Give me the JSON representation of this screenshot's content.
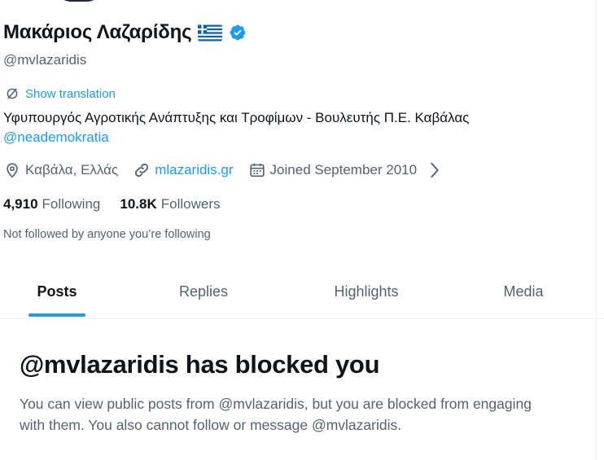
{
  "profile": {
    "display_name": "Μακάριος Λαζαρίδης",
    "flag_icon": "greece-flag-icon",
    "verified_icon": "verified-badge-icon",
    "verified_color": "#1d9bf0",
    "handle": "@mvlazaridis"
  },
  "translation": {
    "icon": "translate-icon",
    "label": "Show translation"
  },
  "bio": {
    "line1": "Υφυπουργός Αγροτικής Ανάπτυξης και Τροφίμων - Βουλευτής Π.Ε. Καβάλας",
    "mention": "@neademokratia"
  },
  "meta": {
    "location": "Καβάλα, Ελλάς",
    "website": "mlazaridis.gr",
    "joined": "Joined September 2010"
  },
  "follow": {
    "following_count": "4,910",
    "following_label": "Following",
    "followers_count": "10.8K",
    "followers_label": "Followers"
  },
  "not_followed_text": "Not followed by anyone you’re following",
  "tabs": [
    {
      "label": "Posts",
      "active": true
    },
    {
      "label": "Replies",
      "active": false
    },
    {
      "label": "Highlights",
      "active": false
    },
    {
      "label": "Media",
      "active": false
    }
  ],
  "blocked": {
    "title": "@mvlazaridis has blocked you",
    "message": "You can view public posts from @mvlazaridis, but you are blocked from engaging with them. You also cannot follow or message @mvlazaridis."
  },
  "colors": {
    "accent": "#1d9bf0",
    "text": "#0f1419",
    "muted": "#536471"
  }
}
